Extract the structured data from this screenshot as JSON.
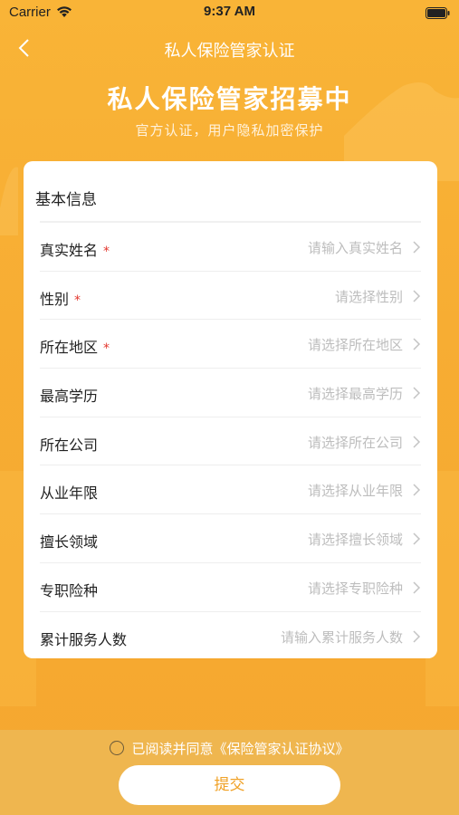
{
  "status_bar": {
    "carrier": "Carrier",
    "time": "9:37 AM",
    "wifi_icon": "wifi-icon",
    "battery_icon": "battery-icon"
  },
  "nav": {
    "back_icon": "chevron-left-icon",
    "title": "私人保险管家认证"
  },
  "hero": {
    "title": "私人保险管家招募中",
    "subtitle": "官方认证，用户隐私加密保护"
  },
  "form": {
    "section_title": "基本信息",
    "required_mark": "*",
    "rows": [
      {
        "label": "真实姓名",
        "placeholder": "请输入真实姓名",
        "required": true
      },
      {
        "label": "性别",
        "placeholder": "请选择性别",
        "required": true
      },
      {
        "label": "所在地区",
        "placeholder": "请选择所在地区",
        "required": true
      },
      {
        "label": "最高学历",
        "placeholder": "请选择最高学历",
        "required": false
      },
      {
        "label": "所在公司",
        "placeholder": "请选择所在公司",
        "required": false
      },
      {
        "label": "从业年限",
        "placeholder": "请选择从业年限",
        "required": false
      },
      {
        "label": "擅长领域",
        "placeholder": "请选择擅长领域",
        "required": false
      },
      {
        "label": "专职险种",
        "placeholder": "请选择专职险种",
        "required": false
      },
      {
        "label": "累计服务人数",
        "placeholder": "请输入累计服务人数",
        "required": false
      }
    ]
  },
  "agreement": {
    "text": "已阅读并同意《保险管家认证协议》",
    "checked": false
  },
  "submit": {
    "label": "提交"
  },
  "colors": {
    "background": "#f7ad33",
    "bottom_bar": "#efb64f",
    "accent_text": "#f0a126",
    "required": "#e3372e",
    "placeholder": "#bdbdbd"
  }
}
